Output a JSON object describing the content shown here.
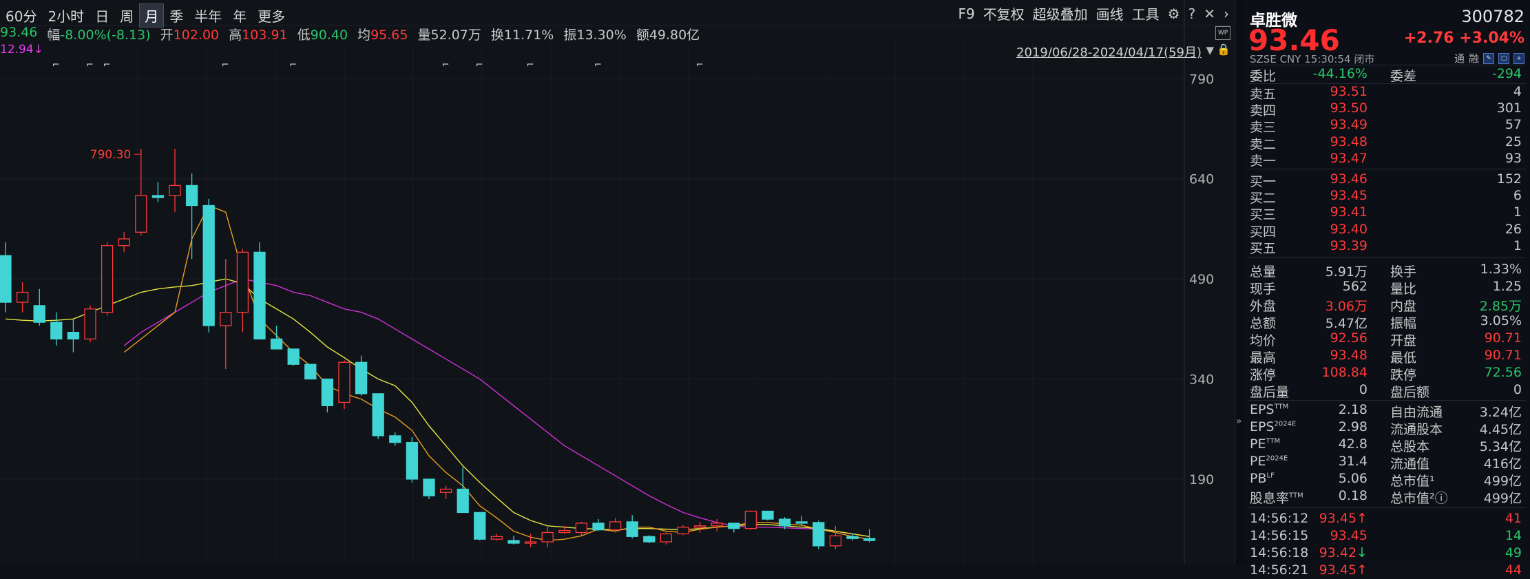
{
  "toolbar": {
    "periods": [
      "60分",
      "2小时",
      "日",
      "周",
      "月",
      "季",
      "半年",
      "年",
      "更多"
    ],
    "active_period": "月",
    "tools": [
      "F9",
      "不复权",
      "超级叠加",
      "画线",
      "工具"
    ]
  },
  "quote": {
    "items": [
      {
        "label": "",
        "value": "93.46",
        "color": "green"
      },
      {
        "label": "幅",
        "value": "-8.00%(-8.13)",
        "color": "green"
      },
      {
        "label": "开",
        "value": "102.00",
        "color": "red"
      },
      {
        "label": "高",
        "value": "103.91",
        "color": "red"
      },
      {
        "label": "低",
        "value": "90.40",
        "color": "green"
      },
      {
        "label": "均",
        "value": "95.65",
        "color": "red"
      },
      {
        "label": "量",
        "value": "52.07万",
        "color": "white"
      },
      {
        "label": "换",
        "value": "11.71%",
        "color": "white"
      },
      {
        "label": "振",
        "value": "13.30%",
        "color": "white"
      },
      {
        "label": "额",
        "value": "49.80亿",
        "color": "white"
      }
    ],
    "ma_value": "12.94↓"
  },
  "range_text": "2019/06/28-2024/04/17(59月)",
  "wp_label": "WP",
  "chart_data": {
    "type": "candlestick",
    "y_ticks": [
      790,
      640,
      490,
      340,
      190
    ],
    "ylim": [
      62,
      844
    ],
    "max_label": "790.30",
    "colors": {
      "up": "#ff3b3b",
      "down": "#40d4d4",
      "ma_fast": "#e8a020",
      "ma_mid": "#e6e640",
      "ma_slow": "#d030d8"
    },
    "candles": [
      [
        525,
        545,
        440,
        455
      ],
      [
        455,
        485,
        440,
        470
      ],
      [
        450,
        475,
        420,
        425
      ],
      [
        425,
        440,
        390,
        400
      ],
      [
        410,
        430,
        380,
        400
      ],
      [
        400,
        450,
        395,
        445
      ],
      [
        440,
        545,
        435,
        540
      ],
      [
        540,
        560,
        530,
        550
      ],
      [
        560,
        685,
        555,
        615
      ],
      [
        615,
        635,
        605,
        612
      ],
      [
        615,
        685,
        590,
        630
      ],
      [
        630,
        648,
        520,
        600
      ],
      [
        600,
        610,
        410,
        420
      ],
      [
        420,
        520,
        355,
        440
      ],
      [
        440,
        535,
        410,
        530
      ],
      [
        530,
        545,
        410,
        400
      ],
      [
        400,
        420,
        385,
        385
      ],
      [
        385,
        378,
        360,
        362
      ],
      [
        362,
        360,
        340,
        340
      ],
      [
        340,
        332,
        290,
        300
      ],
      [
        305,
        368,
        295,
        365
      ],
      [
        365,
        375,
        315,
        318
      ],
      [
        318,
        312,
        250,
        255
      ],
      [
        255,
        260,
        240,
        245
      ],
      [
        245,
        253,
        185,
        190
      ],
      [
        190,
        182,
        160,
        165
      ],
      [
        170,
        180,
        160,
        175
      ],
      [
        175,
        208,
        140,
        140
      ],
      [
        140,
        135,
        98,
        100
      ],
      [
        100,
        108,
        98,
        104
      ],
      [
        98,
        105,
        92,
        94
      ],
      [
        94,
        108,
        88,
        96
      ],
      [
        96,
        120,
        88,
        110
      ],
      [
        110,
        120,
        108,
        113
      ],
      [
        110,
        126,
        106,
        124
      ],
      [
        124,
        130,
        112,
        114
      ],
      [
        114,
        132,
        110,
        126
      ],
      [
        126,
        136,
        101,
        104
      ],
      [
        104,
        106,
        94,
        96
      ],
      [
        96,
        110,
        92,
        108
      ],
      [
        108,
        121,
        106,
        118
      ],
      [
        118,
        126,
        110,
        120
      ],
      [
        120,
        130,
        112,
        124
      ],
      [
        124,
        120,
        110,
        116
      ],
      [
        116,
        143,
        114,
        142
      ],
      [
        142,
        140,
        128,
        130
      ],
      [
        130,
        133,
        115,
        120
      ],
      [
        126,
        135,
        120,
        125
      ],
      [
        125,
        128,
        85,
        90
      ],
      [
        90,
        120,
        85,
        105
      ],
      [
        104,
        108,
        98,
        101
      ],
      [
        101,
        115,
        95,
        98
      ]
    ],
    "ma_fast": [
      null,
      null,
      null,
      null,
      null,
      null,
      null,
      380,
      400,
      420,
      440,
      550,
      600,
      590,
      500,
      430,
      405,
      380,
      360,
      330,
      318,
      310,
      295,
      283,
      263,
      225,
      200,
      180,
      150,
      132,
      112,
      103,
      98,
      100,
      105,
      115,
      112,
      118,
      118,
      112,
      110,
      115,
      118,
      120,
      125,
      125,
      123,
      121,
      115,
      110,
      104,
      100
    ],
    "ma_mid": [
      430,
      428,
      427,
      428,
      430,
      440,
      450,
      460,
      470,
      475,
      478,
      480,
      485,
      490,
      483,
      460,
      445,
      430,
      410,
      388,
      372,
      355,
      340,
      330,
      305,
      270,
      240,
      210,
      185,
      162,
      140,
      128,
      120,
      118,
      116,
      115,
      114,
      116,
      116,
      115,
      114,
      116,
      118,
      120,
      122,
      122,
      120,
      118,
      116,
      112,
      108,
      104
    ],
    "ma_slow": [
      null,
      null,
      null,
      null,
      null,
      null,
      null,
      390,
      410,
      425,
      440,
      455,
      470,
      480,
      490,
      485,
      480,
      470,
      465,
      455,
      445,
      440,
      430,
      415,
      400,
      385,
      370,
      355,
      340,
      320,
      300,
      280,
      260,
      240,
      225,
      210,
      195,
      180,
      165,
      152,
      140,
      132,
      125,
      120,
      118,
      118,
      117,
      116,
      115,
      112,
      108,
      104
    ],
    "event_markers": [
      3,
      5,
      6,
      13,
      17,
      26,
      28,
      31,
      35,
      41
    ]
  },
  "panel": {
    "name": "卓胜微",
    "code": "300782",
    "price": "93.46",
    "change": "+2.76",
    "change_pct": "+3.04%",
    "sub_info": "SZSE  CNY  15:30:54  闭市",
    "sub_tools": [
      "通",
      "融"
    ],
    "ratio": {
      "label1": "委比",
      "value1": "-44.16%",
      "label2": "委差",
      "value2": "-294"
    },
    "asks": [
      {
        "label": "卖五",
        "price": "93.51",
        "vol": "4"
      },
      {
        "label": "卖四",
        "price": "93.50",
        "vol": "301"
      },
      {
        "label": "卖三",
        "price": "93.49",
        "vol": "57"
      },
      {
        "label": "卖二",
        "price": "93.48",
        "vol": "25"
      },
      {
        "label": "卖一",
        "price": "93.47",
        "vol": "93"
      }
    ],
    "bids": [
      {
        "label": "买一",
        "price": "93.46",
        "vol": "152"
      },
      {
        "label": "买二",
        "price": "93.45",
        "vol": "6"
      },
      {
        "label": "买三",
        "price": "93.41",
        "vol": "1"
      },
      {
        "label": "买四",
        "price": "93.40",
        "vol": "26"
      },
      {
        "label": "买五",
        "price": "93.39",
        "vol": "1"
      }
    ],
    "stats": [
      {
        "l1": "总量",
        "v1": "5.91万",
        "c1": "white",
        "l2": "换手",
        "v2": "1.33%",
        "c2": "white"
      },
      {
        "l1": "现手",
        "v1": "562",
        "c1": "white",
        "l2": "量比",
        "v2": "1.25",
        "c2": "white"
      },
      {
        "l1": "外盘",
        "v1": "3.06万",
        "c1": "red",
        "l2": "内盘",
        "v2": "2.85万",
        "c2": "green"
      },
      {
        "l1": "总额",
        "v1": "5.47亿",
        "c1": "white",
        "l2": "振幅",
        "v2": "3.05%",
        "c2": "white"
      },
      {
        "l1": "均价",
        "v1": "92.56",
        "c1": "red",
        "l2": "开盘",
        "v2": "90.71",
        "c2": "red"
      },
      {
        "l1": "最高",
        "v1": "93.48",
        "c1": "red",
        "l2": "最低",
        "v2": "90.71",
        "c2": "red"
      },
      {
        "l1": "涨停",
        "v1": "108.84",
        "c1": "red",
        "l2": "跌停",
        "v2": "72.56",
        "c2": "green"
      },
      {
        "l1": "盘后量",
        "v1": "0",
        "c1": "white",
        "l2": "盘后额",
        "v2": "0",
        "c2": "white"
      }
    ],
    "fundamentals": [
      {
        "l1": "EPS",
        "s1": "TTM",
        "v1": "2.18",
        "l2": "自由流通",
        "v2": "3.24亿"
      },
      {
        "l1": "EPS",
        "s1": "2024E",
        "v1": "2.98",
        "l2": "流通股本",
        "v2": "4.45亿"
      },
      {
        "l1": "PE",
        "s1": "TTM",
        "v1": "42.8",
        "l2": "总股本",
        "v2": "5.34亿"
      },
      {
        "l1": "PE",
        "s1": "2024E",
        "v1": "31.4",
        "l2": "流通值",
        "v2": "416亿"
      },
      {
        "l1": "PB",
        "s1": "LF",
        "v1": "5.06",
        "l2": "总市值¹",
        "v2": "499亿"
      },
      {
        "l1": "股息率",
        "s1": "TTM",
        "v1": "0.18",
        "l2": "总市值²ⓘ",
        "v2": "499亿"
      }
    ],
    "trades": [
      {
        "time": "14:56:12",
        "price": "93.45",
        "dir": "↑",
        "vol": "41",
        "pc": "red",
        "vc": "red"
      },
      {
        "time": "14:56:15",
        "price": "93.45",
        "dir": "",
        "vol": "14",
        "pc": "red",
        "vc": "green"
      },
      {
        "time": "14:56:18",
        "price": "93.42",
        "dir": "↓",
        "vol": "49",
        "pc": "red",
        "vc": "green"
      },
      {
        "time": "14:56:21",
        "price": "93.45",
        "dir": "↑",
        "vol": "44",
        "pc": "red",
        "vc": "red"
      }
    ]
  }
}
